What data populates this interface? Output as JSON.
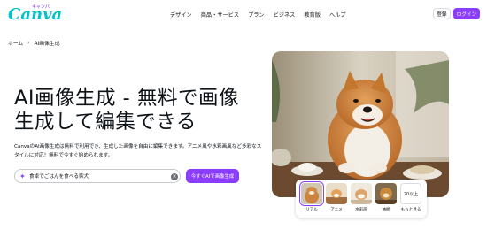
{
  "header": {
    "logo": "Canva",
    "logo_sub": "キャンバ",
    "nav": [
      "デザイン",
      "商品・サービス",
      "プラン",
      "ビジネス",
      "教育版",
      "ヘルプ"
    ],
    "register_label": "登録",
    "login_label": "ログイン"
  },
  "breadcrumb": {
    "home": "ホーム",
    "current": "AI画像生成"
  },
  "hero": {
    "headline": "AI画像生成 - 無料で画像生成して編集できる",
    "description": "CanvaのAI画像生成は無料で利用でき、生成した画像を自由に編集できます。アニメ風や水彩画風など多彩なスタイルに対応！無料で今すぐ始められます。"
  },
  "prompt": {
    "value": "食卓でごはんを食べる柴犬"
  },
  "generate_label": "今すぐAIで画像生成",
  "styles": [
    {
      "label": "リアル"
    },
    {
      "label": "アニメ"
    },
    {
      "label": "水彩画"
    },
    {
      "label": "油絵"
    },
    {
      "label": "もっと見る",
      "count": "20以上"
    }
  ],
  "colors": {
    "brand_purple": "#8b3dff",
    "logo_teal": "#00c4cc",
    "text": "#0e1318"
  }
}
